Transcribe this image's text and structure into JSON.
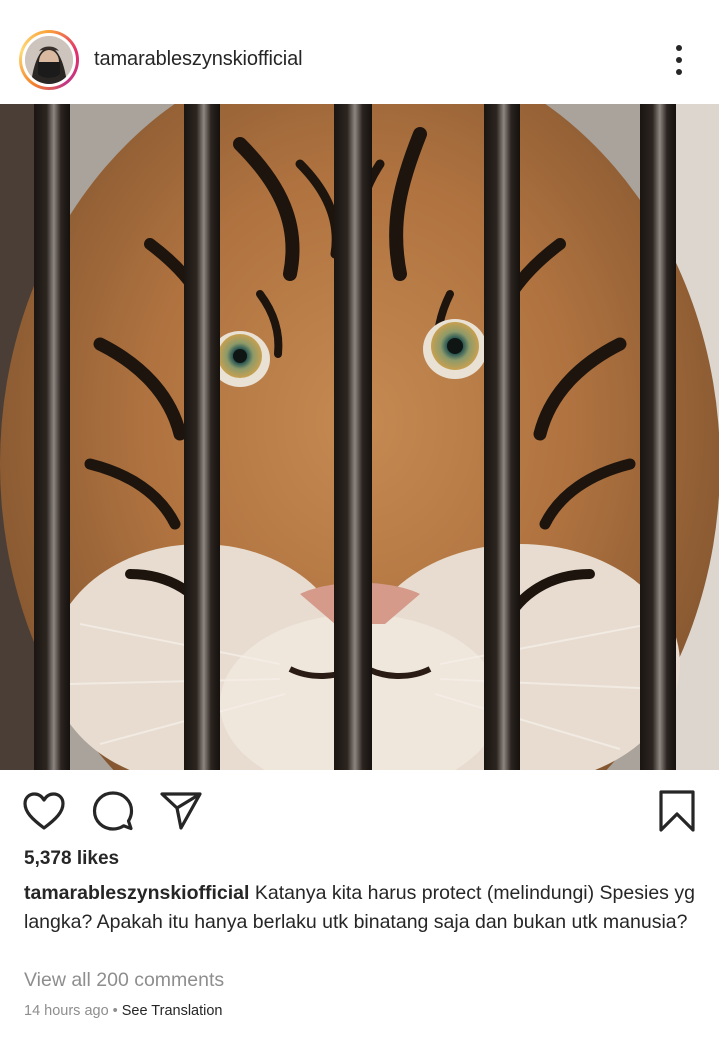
{
  "post": {
    "username": "tamarableszynskiofficial",
    "likes": "5,378 likes",
    "caption_user": "tamarableszynskiofficial",
    "caption_text": "Katanya kita harus protect (melindungi) Spesies yg langka? Apakah itu hanya berlaku utk binatang saja dan bukan utk manusia?",
    "view_comments": "View all 200 comments",
    "time_ago": "14 hours ago",
    "see_translation": "See Translation"
  },
  "icons": {
    "more": "more-vertical-icon",
    "like": "heart-icon",
    "comment": "comment-bubble-icon",
    "share": "send-icon",
    "save": "bookmark-icon"
  },
  "colors": {
    "text": "#262626",
    "muted": "#8e8e8e",
    "ring_start": "#f9a13a",
    "ring_end": "#c13584"
  }
}
